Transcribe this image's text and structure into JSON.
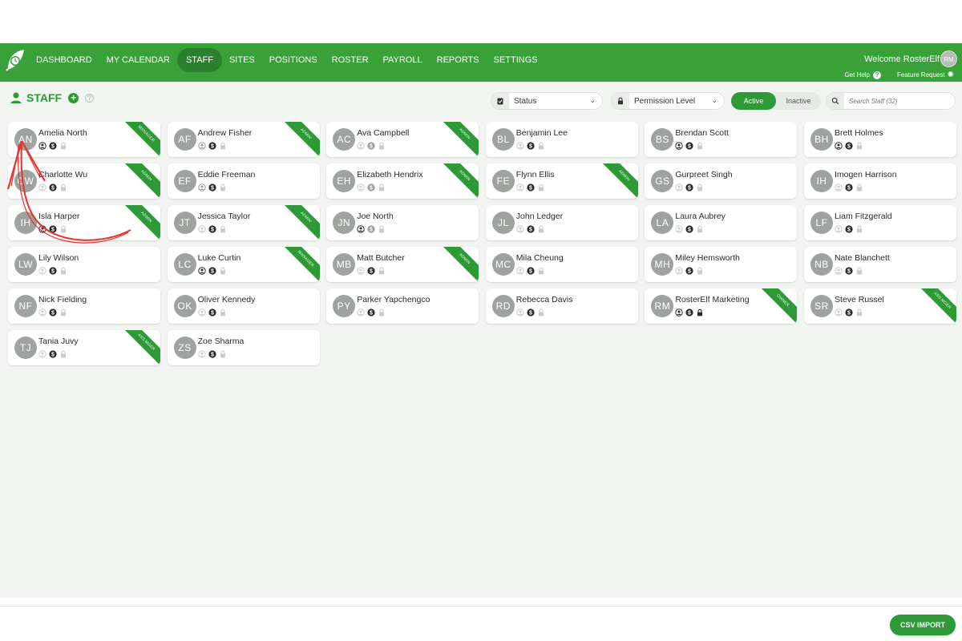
{
  "nav": {
    "items": [
      "DASHBOARD",
      "MY CALENDAR",
      "STAFF",
      "SITES",
      "POSITIONS",
      "ROSTER",
      "PAYROLL",
      "REPORTS",
      "SETTINGS"
    ],
    "active": "STAFF",
    "welcome": "Welcome RosterElf",
    "user_initials": "RM",
    "get_help": "Get Help",
    "feature_request": "Feature Request"
  },
  "toolbar": {
    "title": "STAFF",
    "status_label": "Status",
    "permission_label": "Permission Level",
    "active_label": "Active",
    "inactive_label": "Inactive",
    "search_placeholder": "Search Staff (32)"
  },
  "staff": [
    {
      "initials": "AN",
      "name": "Amelia North",
      "badge": "MANAGER",
      "icons": [
        2,
        2,
        0
      ]
    },
    {
      "initials": "AF",
      "name": "Andrew Fisher",
      "badge": "ADMIN",
      "icons": [
        1,
        2,
        0
      ]
    },
    {
      "initials": "AC",
      "name": "Ava Campbell",
      "badge": "ADMIN",
      "icons": [
        0,
        1,
        0
      ]
    },
    {
      "initials": "BL",
      "name": "Benjamin Lee",
      "badge": "",
      "icons": [
        0,
        2,
        0
      ]
    },
    {
      "initials": "BS",
      "name": "Brendan Scott",
      "badge": "",
      "icons": [
        2,
        2,
        0
      ]
    },
    {
      "initials": "BH",
      "name": "Brett Holmes",
      "badge": "",
      "icons": [
        2,
        2,
        0
      ]
    },
    {
      "initials": "CW",
      "name": "Charlotte Wu",
      "badge": "ADMIN",
      "icons": [
        0,
        2,
        0
      ]
    },
    {
      "initials": "EF",
      "name": "Eddie Freeman",
      "badge": "",
      "icons": [
        1,
        2,
        0
      ]
    },
    {
      "initials": "EH",
      "name": "Elizabeth Hendrix",
      "badge": "ADMIN",
      "icons": [
        0,
        1,
        0
      ]
    },
    {
      "initials": "FE",
      "name": "Flynn Ellis",
      "badge": "ADMIN",
      "icons": [
        0,
        2,
        0
      ]
    },
    {
      "initials": "GS",
      "name": "Gurpreet Singh",
      "badge": "",
      "icons": [
        0,
        2,
        0
      ]
    },
    {
      "initials": "IH",
      "name": "Imogen Harrison",
      "badge": "",
      "icons": [
        0,
        2,
        0
      ]
    },
    {
      "initials": "IH",
      "name": "Isla Harper",
      "badge": "ADMIN",
      "icons": [
        2,
        2,
        0
      ]
    },
    {
      "initials": "JT",
      "name": "Jessica Taylor",
      "badge": "ADMIN",
      "icons": [
        0,
        2,
        0
      ]
    },
    {
      "initials": "JN",
      "name": "Joe North",
      "badge": "",
      "icons": [
        2,
        1,
        0
      ]
    },
    {
      "initials": "JL",
      "name": "John Ledger",
      "badge": "",
      "icons": [
        0,
        2,
        0
      ]
    },
    {
      "initials": "LA",
      "name": "Laura Aubrey",
      "badge": "",
      "icons": [
        0,
        2,
        0
      ]
    },
    {
      "initials": "LF",
      "name": "Liam Fitzgerald",
      "badge": "",
      "icons": [
        0,
        2,
        0
      ]
    },
    {
      "initials": "LW",
      "name": "Lily Wilson",
      "badge": "",
      "icons": [
        0,
        2,
        0
      ]
    },
    {
      "initials": "LC",
      "name": "Luke Curtin",
      "badge": "MANAGER",
      "icons": [
        2,
        2,
        0
      ]
    },
    {
      "initials": "MB",
      "name": "Matt Butcher",
      "badge": "ADMIN",
      "icons": [
        0,
        2,
        0
      ]
    },
    {
      "initials": "MC",
      "name": "Mila Cheung",
      "badge": "",
      "icons": [
        0,
        2,
        0
      ]
    },
    {
      "initials": "MH",
      "name": "Miley Hemsworth",
      "badge": "",
      "icons": [
        0,
        2,
        0
      ]
    },
    {
      "initials": "NB",
      "name": "Nate Blanchett",
      "badge": "",
      "icons": [
        0,
        2,
        0
      ]
    },
    {
      "initials": "NF",
      "name": "Nick Fielding",
      "badge": "",
      "icons": [
        0,
        2,
        0
      ]
    },
    {
      "initials": "OK",
      "name": "Oliver Kennedy",
      "badge": "",
      "icons": [
        0,
        2,
        0
      ]
    },
    {
      "initials": "PY",
      "name": "Parker Yapchengco",
      "badge": "",
      "icons": [
        0,
        2,
        0
      ]
    },
    {
      "initials": "RD",
      "name": "Rebecca Davis",
      "badge": "",
      "icons": [
        0,
        2,
        0
      ]
    },
    {
      "initials": "RM",
      "name": "RosterElf Marketing",
      "badge": "OWNER",
      "icons": [
        2,
        2,
        2
      ]
    },
    {
      "initials": "SR",
      "name": "Steve Russel",
      "badge": "ASS.MGER",
      "icons": [
        0,
        2,
        0
      ]
    },
    {
      "initials": "TJ",
      "name": "Tania Juvy",
      "badge": "ASS.MGER",
      "icons": [
        0,
        2,
        0
      ]
    },
    {
      "initials": "ZS",
      "name": "Zoe Sharma",
      "badge": "",
      "icons": [
        0,
        2,
        0
      ]
    }
  ],
  "footer": {
    "csv_import": "CSV IMPORT"
  },
  "colors": {
    "brand_green": "#3aa03a",
    "dark_green": "#2b7f2f",
    "avatar_grey": "#9fa39f",
    "annotation_red": "#e8322e"
  },
  "icon_names": [
    "profile-icon",
    "dollar-icon",
    "lock-icon"
  ]
}
